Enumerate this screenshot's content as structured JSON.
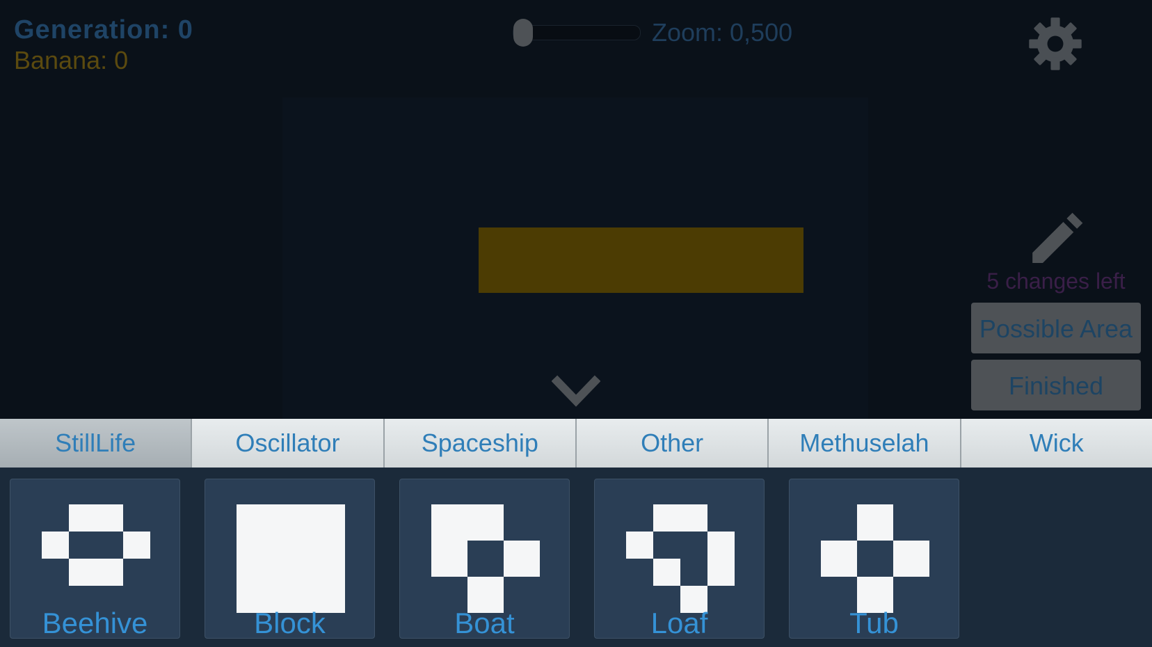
{
  "hud": {
    "generation": "Generation: 0",
    "banana": "Banana: 0"
  },
  "zoom": {
    "label": "Zoom: 0,500",
    "value": 0.5
  },
  "settings": {
    "icon": "gear-icon"
  },
  "edit": {
    "icon": "pencil-icon",
    "changes_left": "5 changes left"
  },
  "buttons": {
    "possible_area": "Possible Area",
    "finished": "Finished"
  },
  "collapse": {
    "icon": "chevron-down-icon"
  },
  "tabs": [
    {
      "label": "StillLife",
      "active": true
    },
    {
      "label": "Oscillator",
      "active": false
    },
    {
      "label": "Spaceship",
      "active": false
    },
    {
      "label": "Other",
      "active": false
    },
    {
      "label": "Methuselah",
      "active": false
    },
    {
      "label": "Wick",
      "active": false
    }
  ],
  "patterns": [
    {
      "label": "Beehive"
    },
    {
      "label": "Block"
    },
    {
      "label": "Boat"
    },
    {
      "label": "Loaf"
    },
    {
      "label": "Tub"
    }
  ],
  "colors": {
    "banana_block": "#4c3c03",
    "tab_text": "#2f7eb8",
    "card_bg": "#2a3e55"
  }
}
